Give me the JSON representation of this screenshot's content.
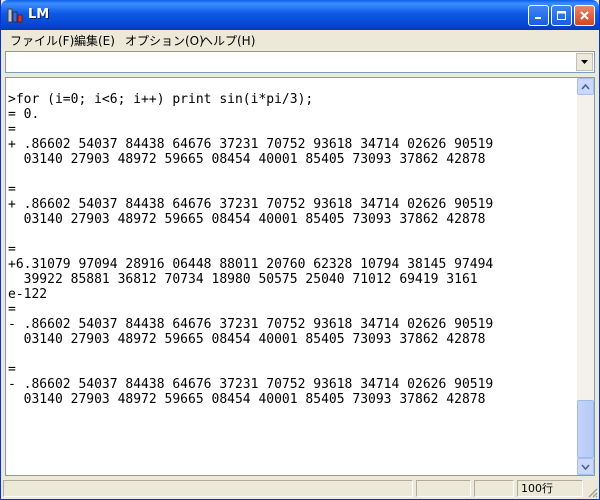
{
  "window": {
    "title": "LM"
  },
  "menu": {
    "file": "ファイル(F)",
    "edit": "編集(E)",
    "options": "オプション(O)",
    "help": "ヘルプ(H)"
  },
  "command": {
    "value": ""
  },
  "editor": {
    "lines": [
      ">for (i=0; i<6; i++) print sin(i*pi/3);",
      "= 0.",
      "=",
      "+ .86602 54037 84438 64676 37231 70752 93618 34714 02626 90519",
      "  03140 27903 48972 59665 08454 40001 85405 73093 37862 42878",
      "",
      "=",
      "+ .86602 54037 84438 64676 37231 70752 93618 34714 02626 90519",
      "  03140 27903 48972 59665 08454 40001 85405 73093 37862 42878",
      "",
      "=",
      "+6.31079 97094 28916 06448 88011 20760 62328 10794 38145 97494",
      "  39922 85881 36812 70734 18980 50575 25040 71012 69419 3161",
      "e-122",
      "=",
      "- .86602 54037 84438 64676 37231 70752 93618 34714 02626 90519",
      "  03140 27903 48972 59665 08454 40001 85405 73093 37862 42878",
      "",
      "=",
      "- .86602 54037 84438 64676 37231 70752 93618 34714 02626 90519",
      "  03140 27903 48972 59665 08454 40001 85405 73093 37862 42878"
    ]
  },
  "status": {
    "line_count": "100行"
  },
  "icons": {
    "app": "lm-app-icon",
    "minimize": "minimize-icon",
    "maximize": "maximize-icon",
    "close": "close-icon",
    "dropdown": "chevron-down-icon",
    "scroll_up": "arrow-up-icon",
    "scroll_down": "arrow-down-icon"
  },
  "colors": {
    "title_bar": "#0A5FEA",
    "window_face": "#ECE9D8",
    "close_button": "#D2461E",
    "editor_bg": "#FFFFFF",
    "text": "#000000"
  }
}
